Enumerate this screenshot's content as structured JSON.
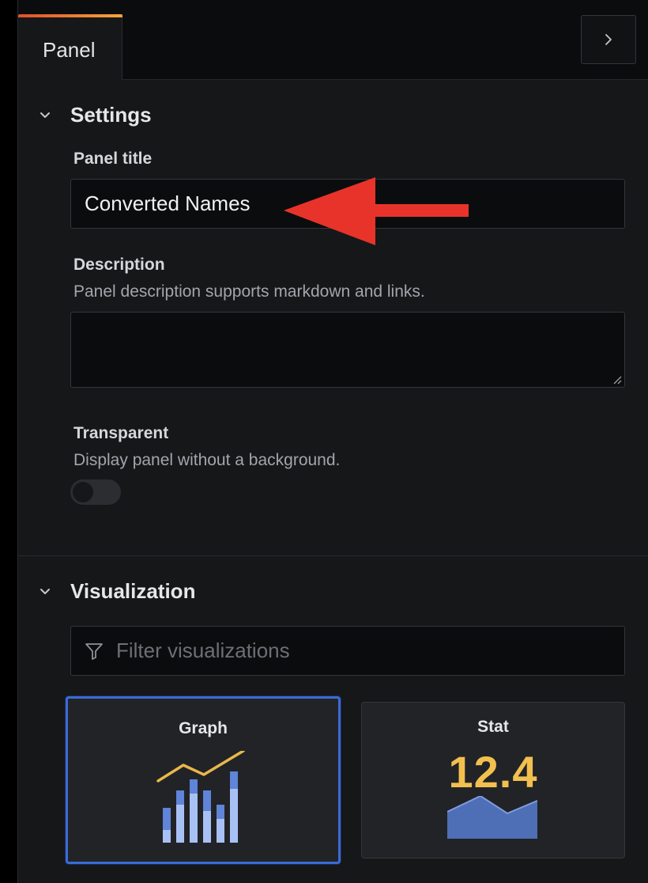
{
  "tabs": [
    {
      "label": "Panel"
    }
  ],
  "settings": {
    "title": "Settings",
    "panel_title_label": "Panel title",
    "panel_title_value": "Converted Names",
    "description_label": "Description",
    "description_help": "Panel description supports markdown and links.",
    "description_value": "",
    "transparent_label": "Transparent",
    "transparent_help": "Display panel without a background.",
    "transparent_enabled": false
  },
  "visualization": {
    "title": "Visualization",
    "filter_placeholder": "Filter visualizations",
    "cards": [
      {
        "name": "Graph",
        "selected": true
      },
      {
        "name": "Stat",
        "selected": false,
        "value": "12.4"
      }
    ]
  },
  "colors": {
    "accent_selected": "#3b6bd6",
    "stat_value": "#f2c04f",
    "annotation_arrow": "#e8332a"
  },
  "icons": {
    "collapse": "chevron-right-icon",
    "section_caret": "chevron-down-icon",
    "filter": "filter-icon"
  }
}
